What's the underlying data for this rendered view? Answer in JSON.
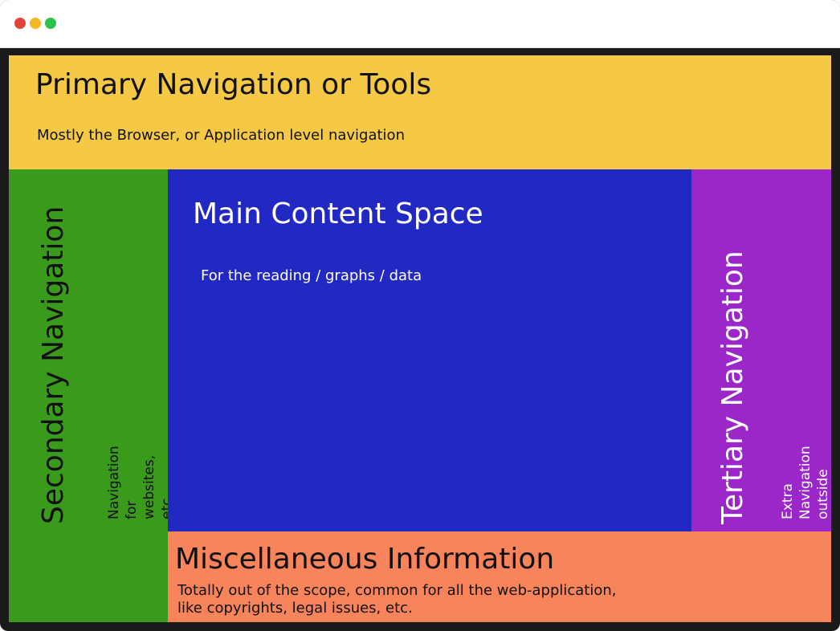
{
  "colors": {
    "frame": "#1a1a1a",
    "primary": "#f5c946",
    "secondary": "#3a9a1c",
    "main": "#2228c2",
    "tertiary": "#9c27c8",
    "misc": "#f7845a",
    "close_dot": "#e0443a",
    "minimize_dot": "#f5b824",
    "maximize_dot": "#2ac24a"
  },
  "primary": {
    "title": "Primary Navigation or Tools",
    "description": "Mostly the Browser, or Application level navigation"
  },
  "secondary": {
    "title": "Secondary Navigation",
    "description": "Navigation for websites, etc\nSpecific to the content"
  },
  "main": {
    "title": "Main Content Space",
    "description": "For the reading / graphs / data"
  },
  "tertiary": {
    "title": "Tertiary Navigation",
    "description": "Extra Navigation\noutside the content scope..."
  },
  "misc": {
    "title": "Miscellaneous Information",
    "description": "Totally out of the scope, common for all the web-application,\nlike copyrights, legal issues, etc."
  }
}
